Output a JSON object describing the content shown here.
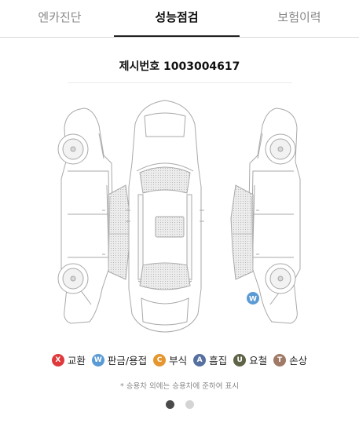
{
  "tabs": [
    {
      "label": "엔카진단"
    },
    {
      "label": "성능점검"
    },
    {
      "label": "보험이력"
    }
  ],
  "active_tab": 1,
  "serial": "제시번호 1003004617",
  "diagram_marks": [
    {
      "code": "W",
      "color": "#5b9bd5"
    }
  ],
  "legend": [
    {
      "code": "X",
      "label": "교환",
      "color": "#e0393b"
    },
    {
      "code": "W",
      "label": "판금/용접",
      "color": "#5b9bd5"
    },
    {
      "code": "C",
      "label": "부식",
      "color": "#e6962f"
    },
    {
      "code": "A",
      "label": "흠집",
      "color": "#5670a0"
    },
    {
      "code": "U",
      "label": "요철",
      "color": "#5f6446"
    },
    {
      "code": "T",
      "label": "손상",
      "color": "#a07a66"
    }
  ],
  "note": "* 승용차 외에는 승용차에 준하여 표시",
  "pagination": {
    "count": 2,
    "active": 0
  }
}
